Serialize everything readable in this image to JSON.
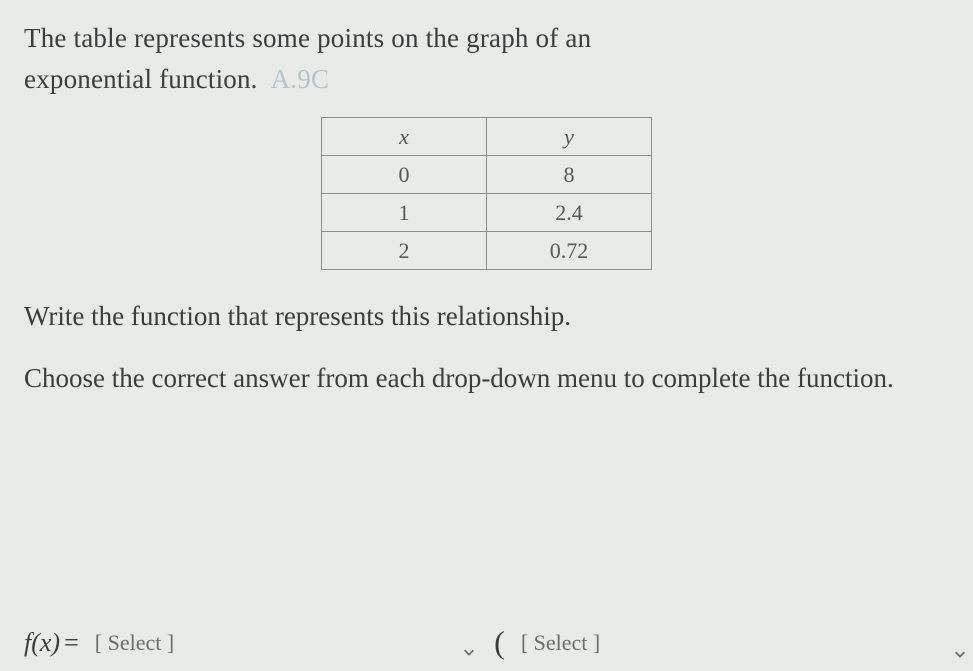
{
  "prompt": {
    "line1": "The table represents some points on the graph of an",
    "line2_prefix": "exponential function.",
    "standard_tag": "A.9C"
  },
  "chart_data": {
    "type": "table",
    "headers": [
      "x",
      "y"
    ],
    "rows": [
      {
        "x": "0",
        "y": "8"
      },
      {
        "x": "1",
        "y": "2.4"
      },
      {
        "x": "2",
        "y": "0.72"
      }
    ]
  },
  "instructions": {
    "write": "Write the function that represents this relationship.",
    "choose": "Choose the correct answer from each drop-down menu to complete the function."
  },
  "function_row": {
    "fn_label": "f(x)",
    "equals": "=",
    "select1": "[ Select ]",
    "paren": "(",
    "select2": "[ Select ]"
  }
}
